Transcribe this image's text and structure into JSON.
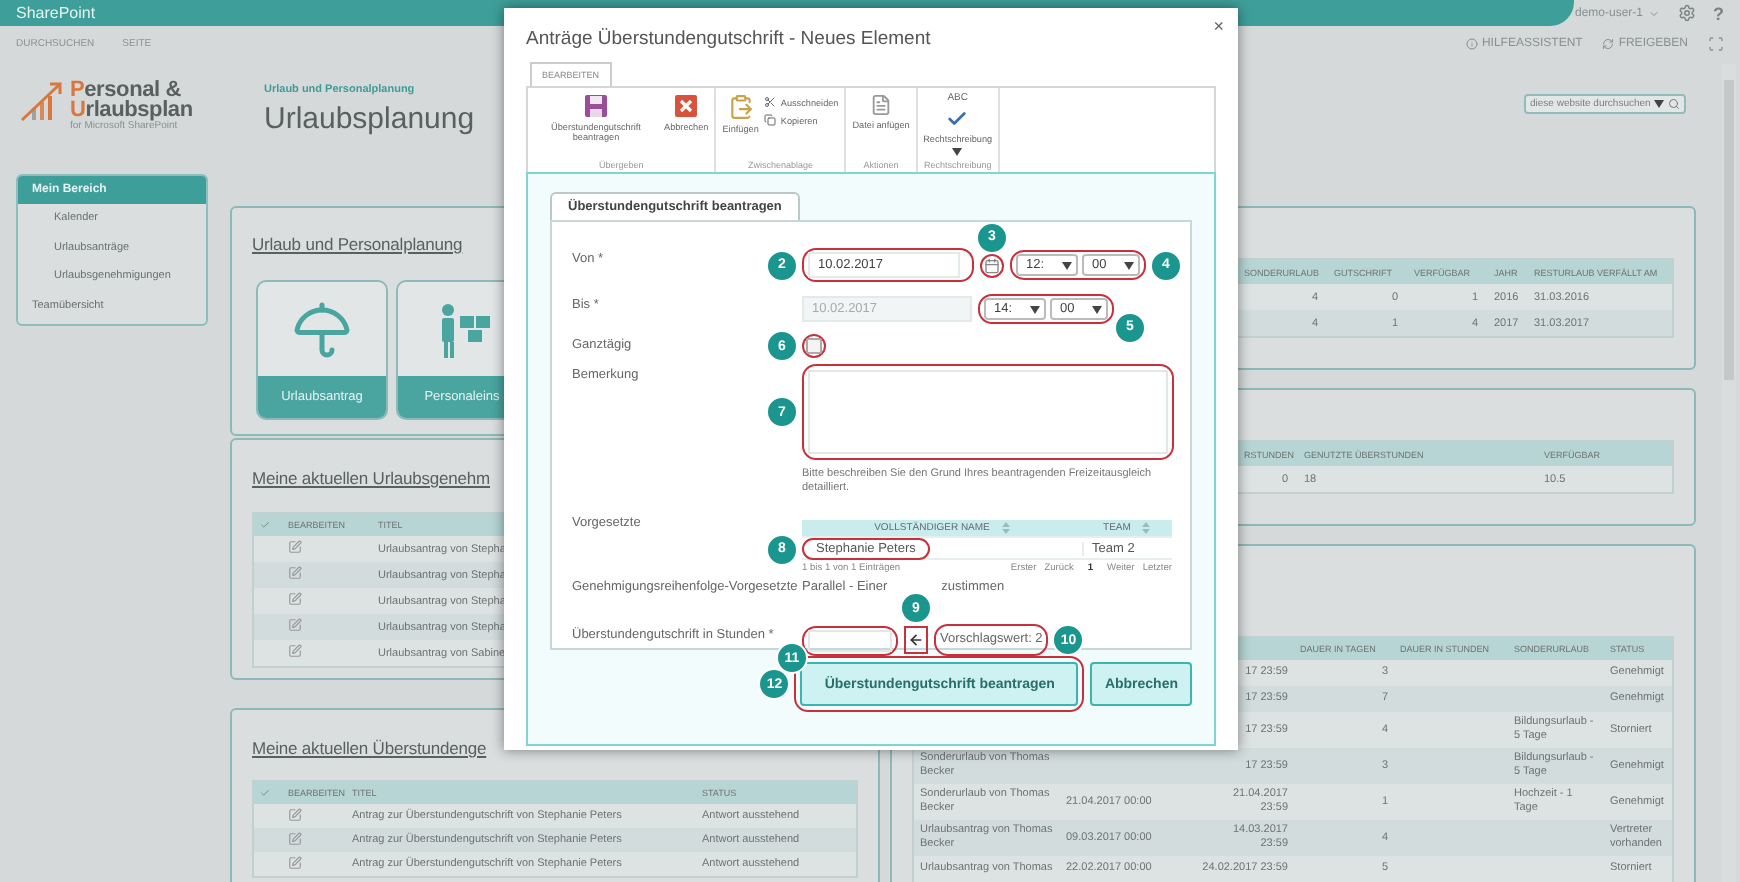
{
  "top_bar": {
    "brand": "SharePoint",
    "user": "demo-user-1",
    "help": "?"
  },
  "sub_bar": {
    "links": [
      "DURCHSUCHEN",
      "SEITE"
    ],
    "actions": [
      {
        "label": "HILFEASSISTENT",
        "kind": "info"
      },
      {
        "label": "FREIGEBEN",
        "kind": "share"
      }
    ]
  },
  "header": {
    "logo": {
      "line1": "Personal &",
      "line2": "Urlaubsplan",
      "tagline": "for Microsoft SharePoint"
    },
    "breadcrumb": "Urlaub und Personalplanung",
    "title": "Urlaubsplanung",
    "search": {
      "placeholder": "diese website durchsuchen"
    }
  },
  "nav": [
    {
      "label": "Mein Bereich",
      "selected": true,
      "children": [
        {
          "label": "Kalender",
          "selected": false
        },
        {
          "label": "Urlaubsanträge",
          "selected": false
        },
        {
          "label": "Urlaubsgenehmigungen",
          "selected": false
        }
      ]
    },
    {
      "label": "Teamübersicht",
      "selected": false
    }
  ],
  "left_panels": [
    {
      "kind": "tiles",
      "title": "Urlaub und Personalplanung",
      "tiles": [
        {
          "label": "Urlaubsantrag",
          "kind": "umbrella"
        },
        {
          "label": "Personaleins",
          "kind": "staff"
        }
      ]
    },
    {
      "kind": "list",
      "title": "Meine aktuellen Urlaubsgenehm",
      "columns": [
        "BEARBEITEN",
        "TITEL"
      ],
      "rows": [
        {
          "title": "Urlaubsantrag von Stepha"
        },
        {
          "title": "Urlaubsantrag von Stepha"
        },
        {
          "title": "Urlaubsantrag von Stepha"
        },
        {
          "title": "Urlaubsantrag von Stepha"
        },
        {
          "title": "Urlaubsantrag von Sabine"
        }
      ]
    },
    {
      "kind": "list",
      "title": "Meine aktuellen Überstundenge",
      "columns": [
        "BEARBEITEN",
        "TITEL",
        "STATUS"
      ],
      "rows": [
        {
          "title": "Antrag zur Überstundengutschrift von Stephanie Peters",
          "status": "Antwort ausstehend"
        },
        {
          "title": "Antrag zur Überstundengutschrift von Stephanie Peters",
          "status": "Antwort ausstehend"
        },
        {
          "title": "Antrag zur Überstundengutschrift von Stephanie Peters",
          "status": "Antwort ausstehend"
        }
      ]
    }
  ],
  "right_panels": [
    {
      "kind": "balance",
      "columns": [
        "SONDERURLAUB",
        "GUTSCHRIFT",
        "VERFÜGBAR",
        "JAHR",
        "RESTURLAUB VERFÄLLT AM"
      ],
      "rows": [
        [
          "4",
          "0",
          "1",
          "2016",
          "31.03.2016"
        ],
        [
          "4",
          "1",
          "4",
          "2017",
          "31.03.2017"
        ]
      ]
    },
    {
      "kind": "overtime",
      "columns": [
        "RSTUNDEN",
        "GENUTZTE ÜBERSTUNDEN",
        "VERFÜGBAR"
      ],
      "rows": [
        [
          "0",
          "18",
          "10.5"
        ]
      ]
    },
    {
      "kind": "requests",
      "columns": [
        "DAUER IN TAGEN",
        "DAUER IN STUNDEN",
        "SONDERURLAUB",
        "STATUS"
      ],
      "rows": [
        {
          "end": "17 23:59",
          "days": "3",
          "status": "Genehmigt"
        },
        {
          "end": "17 23:59",
          "days": "7",
          "status": "Genehmigt"
        },
        {
          "end": "17 23:59",
          "days": "4",
          "special": "Bildungsurlaub - 5 Tage",
          "status": "Storniert"
        },
        {
          "title": "Sonderurlaub von Thomas Becker",
          "end": "17 23:59",
          "days": "3",
          "special": "Bildungsurlaub - 5 Tage",
          "status": "Genehmigt"
        },
        {
          "title": "Sonderurlaub von Thomas Becker",
          "start": "21.04.2017 00:00",
          "end": "21.04.2017 23:59",
          "days": "1",
          "special": "Hochzeit - 1 Tage",
          "status": "Genehmigt"
        },
        {
          "title": "Urlaubsantrag von Thomas Becker",
          "start": "09.03.2017 00:00",
          "end": "14.03.2017 23:59",
          "days": "4",
          "status": "Vertreter vorhanden"
        },
        {
          "title": "Urlaubsantrag von Thomas",
          "start": "22.02.2017 00:00",
          "end": "24.02.2017 23:59",
          "days": "5",
          "status": "Storniert"
        }
      ]
    }
  ],
  "dialog": {
    "title": "Anträge Überstundengutschrift - Neues Element",
    "close": "×",
    "ribbon": {
      "tabs": [
        {
          "label": "BEARBEITEN",
          "selected": true
        }
      ],
      "groups": [
        {
          "label": "Übergeben",
          "commands": [
            {
              "label": "Überstundengutschrift beantragen",
              "kind": "save"
            },
            {
              "label": "Abbrechen",
              "kind": "cancel"
            }
          ]
        },
        {
          "label": "Zwischenablage",
          "commands": [
            {
              "label": "Einfügen",
              "kind": "paste"
            },
            {
              "label": "Ausschneiden",
              "kind": "cut"
            },
            {
              "label": "Kopieren",
              "kind": "copy"
            }
          ]
        },
        {
          "label": "Aktionen",
          "commands": [
            {
              "label": "Datei anfügen",
              "kind": "attach"
            }
          ]
        },
        {
          "label": "Rechtschreibung",
          "commands": [
            {
              "label": "Rechtschreibung",
              "kind": "spelling",
              "icon_label": "ABC"
            }
          ]
        }
      ]
    },
    "form": {
      "tab": "Überstundengutschrift beantragen",
      "fields": [
        {
          "kind": "datetime",
          "label": "Von *",
          "date": "10.02.2017",
          "hour": "12:",
          "minute": "00",
          "disabled": false,
          "date_badge": "2",
          "calendar_badge": "3",
          "time_badge": "4"
        },
        {
          "kind": "datetime",
          "label": "Bis *",
          "date": "10.02.2017",
          "hour": "14:",
          "minute": "00",
          "disabled": true,
          "time_badge": "5"
        },
        {
          "kind": "checkbox",
          "label": "Ganztägig",
          "checked": false,
          "badge": "6"
        },
        {
          "kind": "textarea",
          "label": "Bemerkung",
          "badge": "7",
          "hint": "Bitte beschreiben Sie den Grund Ihres beantragenden Freizeitausgleich detailliert."
        },
        {
          "kind": "people",
          "label": "Vorgesetzte",
          "columns": [
            "VOLLSTÄNDIGER NAME",
            "TEAM"
          ],
          "rows": [
            {
              "name": "Stephanie Peters",
              "team": "Team 2",
              "badge": "8"
            }
          ],
          "info": "1 bis 1 von 1 Einträgen",
          "pager": [
            {
              "label": "Erster",
              "selected": false
            },
            {
              "label": "Zurück",
              "selected": false
            },
            {
              "label": "1",
              "selected": true
            },
            {
              "label": "Weiter",
              "selected": false
            },
            {
              "label": "Letzter",
              "selected": false
            }
          ]
        },
        {
          "kind": "text",
          "label": "Genehmigungsreihenfolge-Vorgesetzte",
          "value_parts": [
            "Parallel - Einer",
            "zustimmen"
          ]
        },
        {
          "kind": "number",
          "label": "Überstundengutschrift in Stunden *",
          "badge": "11",
          "copy_badge": "9",
          "suggestion": "Vorschlagswert: 2",
          "suggestion_badge": "10"
        }
      ]
    },
    "buttons": [
      {
        "label": "Überstundengutschrift beantragen",
        "kind": "primary",
        "badge": "12"
      },
      {
        "label": "Abbrechen",
        "kind": "secondary"
      }
    ]
  }
}
